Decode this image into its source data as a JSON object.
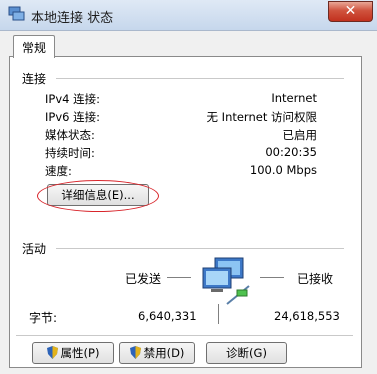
{
  "window": {
    "title": "本地连接 状态",
    "close_label": "✕"
  },
  "tabs": [
    {
      "label": "常规"
    }
  ],
  "connection": {
    "section_label": "连接",
    "rows": [
      {
        "label": "IPv4 连接:",
        "value": "Internet"
      },
      {
        "label": "IPv6 连接:",
        "value": "无 Internet 访问权限"
      },
      {
        "label": "媒体状态:",
        "value": "已启用"
      },
      {
        "label": "持续时间:",
        "value": "00:20:35"
      },
      {
        "label": "速度:",
        "value": "100.0 Mbps"
      }
    ],
    "details_button": "详细信息(E)..."
  },
  "activity": {
    "section_label": "活动",
    "sent_label": "已发送",
    "received_label": "已接收",
    "bytes_label": "字节:",
    "bytes_sent": "6,640,331",
    "bytes_received": "24,618,553"
  },
  "buttons": {
    "properties": "属性(P)",
    "disable": "禁用(D)",
    "diagnose": "诊断(G)"
  },
  "colors": {
    "highlight_oval": "#d8252b",
    "title_bar": "#c6d7ec"
  },
  "icons": [
    "network-connection-icon",
    "close-icon",
    "network-activity-icon",
    "uac-shield-icon"
  ]
}
